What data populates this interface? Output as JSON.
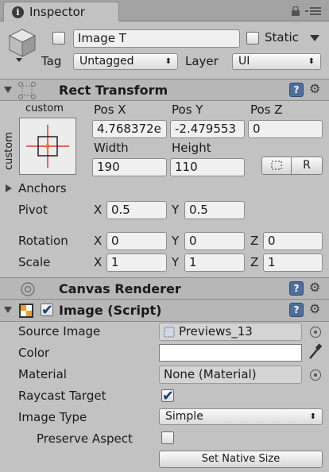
{
  "window": {
    "tab_label": "Inspector"
  },
  "header": {
    "object_name": "Image T",
    "static_label": "Static",
    "tag_label": "Tag",
    "tag_value": "Untagged",
    "layer_label": "Layer",
    "layer_value": "UI"
  },
  "rect_transform": {
    "title": "Rect Transform",
    "anchor_top_label": "custom",
    "anchor_side_label": "custom",
    "pos_x_label": "Pos X",
    "pos_y_label": "Pos Y",
    "pos_z_label": "Pos Z",
    "pos_x": "4.768372e",
    "pos_y": "-2.479553",
    "pos_z": "0",
    "width_label": "Width",
    "height_label": "Height",
    "width": "190",
    "height": "110",
    "raw_edit_button": "R",
    "anchors_label": "Anchors",
    "pivot_label": "Pivot",
    "pivot_x": "0.5",
    "pivot_y": "0.5",
    "rotation_label": "Rotation",
    "rotation_x": "0",
    "rotation_y": "0",
    "rotation_z": "0",
    "scale_label": "Scale",
    "scale_x": "1",
    "scale_y": "1",
    "scale_z": "1",
    "axis_x": "X",
    "axis_y": "Y",
    "axis_z": "Z"
  },
  "canvas_renderer": {
    "title": "Canvas Renderer"
  },
  "image_script": {
    "title": "Image (Script)",
    "source_image_label": "Source Image",
    "source_image_value": "Previews_13",
    "color_label": "Color",
    "color_value": "#ffffff",
    "material_label": "Material",
    "material_value": "None (Material)",
    "raycast_label": "Raycast Target",
    "raycast_checked": true,
    "image_type_label": "Image Type",
    "image_type_value": "Simple",
    "preserve_aspect_label": "Preserve Aspect",
    "preserve_aspect_checked": false,
    "set_native_size_button": "Set Native Size"
  },
  "icons": {
    "help": "?",
    "gear": "⚙",
    "info": "i",
    "popup_arrows": "⬍"
  }
}
